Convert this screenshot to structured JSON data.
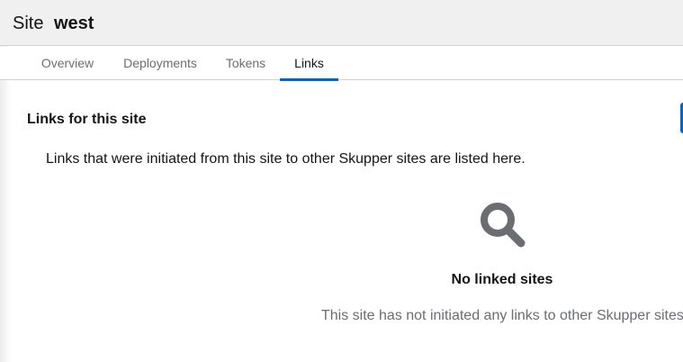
{
  "header": {
    "label": "Site",
    "site_name": "west"
  },
  "tabs": [
    {
      "label": "Overview",
      "active": false
    },
    {
      "label": "Deployments",
      "active": false
    },
    {
      "label": "Tokens",
      "active": false
    },
    {
      "label": "Links",
      "active": true
    }
  ],
  "links_section": {
    "title": "Links for this site",
    "description": "Links that were initiated from this site to other Skupper sites are listed here."
  },
  "empty_state": {
    "icon": "search-icon",
    "title": "No linked sites",
    "body": "This site has not initiated any links to other Skupper sites."
  },
  "colors": {
    "accent": "#0066cc",
    "header_bg": "#f0f0f0",
    "muted_text": "#6a6e73",
    "icon": "#6a6e73"
  }
}
